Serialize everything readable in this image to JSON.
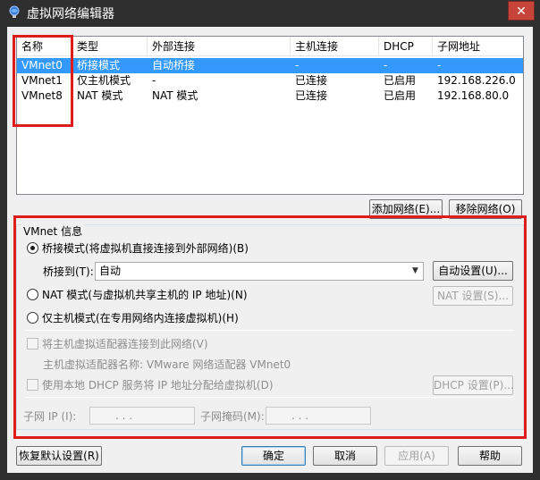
{
  "window": {
    "title": "虚拟网络编辑器",
    "close_glyph": "✕"
  },
  "network_list": {
    "columns": [
      "名称",
      "类型",
      "外部连接",
      "主机连接",
      "DHCP",
      "子网地址"
    ],
    "rows": [
      {
        "name": "VMnet0",
        "type": "桥接模式",
        "external": "自动桥接",
        "host": "-",
        "dhcp": "-",
        "subnet": "-",
        "selected": true
      },
      {
        "name": "VMnet1",
        "type": "仅主机模式",
        "external": "-",
        "host": "已连接",
        "dhcp": "已启用",
        "subnet": "192.168.226.0"
      },
      {
        "name": "VMnet8",
        "type": "NAT 模式",
        "external": "NAT 模式",
        "host": "已连接",
        "dhcp": "已启用",
        "subnet": "192.168.80.0"
      }
    ]
  },
  "list_buttons": {
    "add": "添加网络(E)...",
    "remove": "移除网络(O)"
  },
  "vmnet_info": {
    "title": "VMnet 信息",
    "bridged_label": "桥接模式(将虚拟机直接连接到外部网络)(B)",
    "bridge_to_label": "桥接到(T):",
    "bridge_to_value": "自动",
    "auto_settings": "自动设置(U)...",
    "nat_label": "NAT 模式(与虚拟机共享主机的 IP 地址)(N)",
    "nat_settings": "NAT 设置(S)...",
    "hostonly_label": "仅主机模式(在专用网络内连接虚拟机)(H)",
    "connect_adapter_label": "将主机虚拟适配器连接到此网络(V)",
    "adapter_name_label": "主机虚拟适配器名称: VMware 网络适配器 VMnet0",
    "dhcp_label": "使用本地 DHCP 服务将 IP 地址分配给虚拟机(D)",
    "dhcp_settings": "DHCP 设置(P)...",
    "subnet_ip_label": "子网 IP (I):",
    "subnet_mask_label": "子网掩码(M):",
    "ip_dots": ".    .    ."
  },
  "footer": {
    "restore": "恢复默认设置(R)",
    "ok": "确定",
    "cancel": "取消",
    "apply": "应用(A)",
    "help": "帮助"
  },
  "colors": {
    "highlight": "#3399ff",
    "annotation_red": "#e01b1b"
  }
}
